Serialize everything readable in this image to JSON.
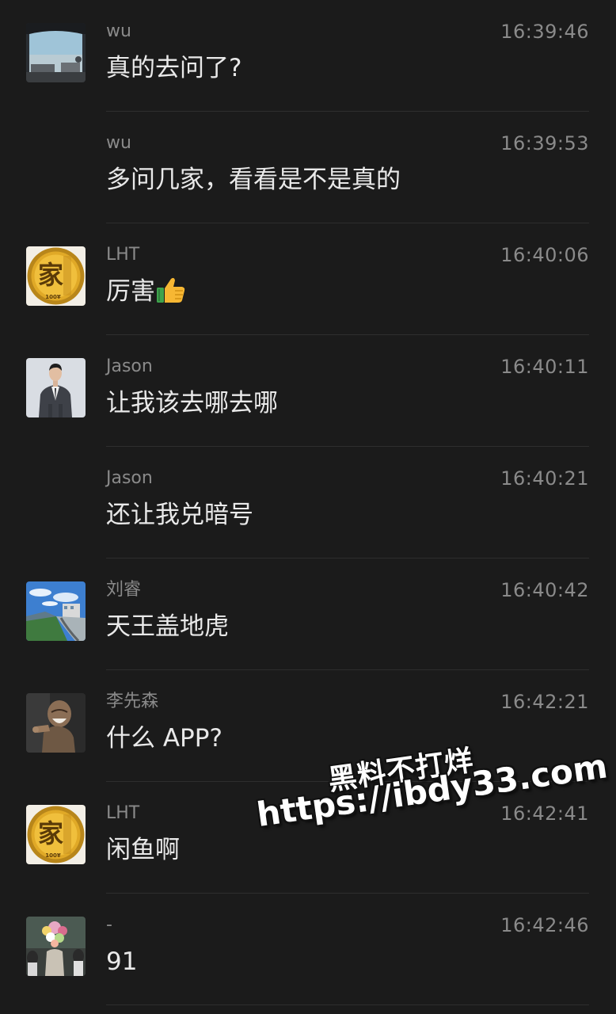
{
  "messages": [
    {
      "sender": "wu",
      "time": "16:39:46",
      "text": "真的去问了?",
      "avatar": "car-window-photo"
    },
    {
      "sender": "wu",
      "time": "16:39:53",
      "text": "多问几家，看看是不是真的",
      "avatar": null
    },
    {
      "sender": "LHT",
      "time": "16:40:06",
      "text": "厉害",
      "avatar": "gold-coin-jia",
      "emoji": "thumbs-up"
    },
    {
      "sender": "Jason",
      "time": "16:40:11",
      "text": "让我该去哪去哪",
      "avatar": "man-in-suit"
    },
    {
      "sender": "Jason",
      "time": "16:40:21",
      "text": "还让我兑暗号",
      "avatar": null
    },
    {
      "sender": "刘睿",
      "time": "16:40:42",
      "text": "天王盖地虎",
      "avatar": "coastal-landscape"
    },
    {
      "sender": "李先森",
      "time": "16:42:21",
      "text": "什么 APP?",
      "avatar": "laughing-statue"
    },
    {
      "sender": "LHT",
      "time": "16:42:41",
      "text": "闲鱼啊",
      "avatar": "gold-coin-jia"
    },
    {
      "sender": "-",
      "time": "16:42:46",
      "text": "91",
      "avatar": "flower-crowd"
    }
  ],
  "coin": {
    "char": "家",
    "label": "100¥"
  },
  "watermark": {
    "line1": "黑料不打烊",
    "line2": "https://ibdy33.com"
  },
  "colors": {
    "background": "#1b1b1b",
    "sender": "#8a8a8a",
    "message": "#e9e9e9",
    "divider": "#2e2e2e"
  }
}
